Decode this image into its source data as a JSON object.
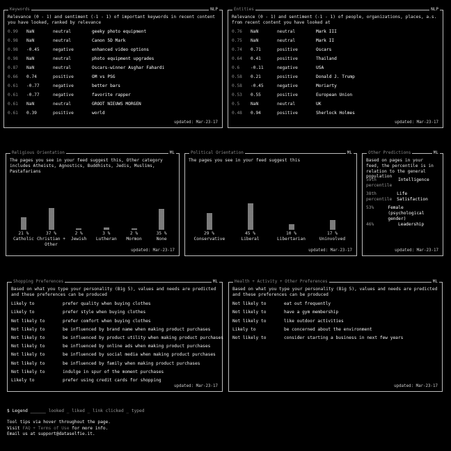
{
  "keywords": {
    "title": "Keywords",
    "tag": "NLP",
    "desc": "Relevance (0 - 1) and sentiment (-1 - 1) of important keywords in recent content you have looked, ranked by relevance",
    "rows": [
      {
        "rel": "0.99",
        "score": "NaN",
        "label": "neutral",
        "text": "geeky photo equipment"
      },
      {
        "rel": "0.98",
        "score": "NaN",
        "label": "neutral",
        "text": "Canon 5D Mark"
      },
      {
        "rel": "0.98",
        "score": "-0.45",
        "label": "negative",
        "text": "enhanced video options"
      },
      {
        "rel": "0.98",
        "score": "NaN",
        "label": "neutral",
        "text": "photo equipment upgrades"
      },
      {
        "rel": "0.87",
        "score": "NaN",
        "label": "neutral",
        "text": "Oscars-winner Asghar Fahardi"
      },
      {
        "rel": "0.66",
        "score": "0.74",
        "label": "positive",
        "text": "OM vs PSG"
      },
      {
        "rel": "0.61",
        "score": "-0.77",
        "label": "negative",
        "text": "better bars"
      },
      {
        "rel": "0.61",
        "score": "-0.77",
        "label": "negative",
        "text": "favorite rapper"
      },
      {
        "rel": "0.61",
        "score": "NaN",
        "label": "neutral",
        "text": "GROOT NIEUWS MORGEN"
      },
      {
        "rel": "0.61",
        "score": "0.39",
        "label": "positive",
        "text": "world"
      }
    ],
    "updated": "updated: Mar-23-17"
  },
  "entities": {
    "title": "Entities",
    "tag": "NLP",
    "desc": "Relevance (0 - 1) and sentiment (-1 - 1) of people, organizations, places, a.s. from recent content you have looked at",
    "rows": [
      {
        "rel": "0.76",
        "score": "NaN",
        "label": "neutral",
        "text": "Mark III"
      },
      {
        "rel": "0.75",
        "score": "NaN",
        "label": "neutral",
        "text": "Mark II"
      },
      {
        "rel": "0.74",
        "score": "0.71",
        "label": "positive",
        "text": "Oscars"
      },
      {
        "rel": "0.64",
        "score": "0.41",
        "label": "positive",
        "text": "Thailand"
      },
      {
        "rel": "0.6",
        "score": "-0.11",
        "label": "negative",
        "text": "USA"
      },
      {
        "rel": "0.58",
        "score": "0.21",
        "label": "positive",
        "text": "Donald J. Trump"
      },
      {
        "rel": "0.58",
        "score": "-0.45",
        "label": "negative",
        "text": "Moriarty"
      },
      {
        "rel": "0.53",
        "score": "0.55",
        "label": "positive",
        "text": "European Union"
      },
      {
        "rel": "0.5",
        "score": "NaN",
        "label": "neutral",
        "text": "UK"
      },
      {
        "rel": "0.48",
        "score": "0.94",
        "label": "positive",
        "text": "Sherlock Holmes"
      }
    ],
    "updated": "updated: Mar-23-17"
  },
  "religious": {
    "title": "Religious Orientation",
    "tag": "ML",
    "desc": "The pages you see in your feed suggest this, Other category includes Atheists, Agnostics, Buddhists, Jedis, Muslims, Pastafarians",
    "bars": [
      {
        "pct": "21 %",
        "label": "Catholic",
        "value": 21
      },
      {
        "pct": "37 %",
        "label": "Christian + Other",
        "value": 37
      },
      {
        "pct": "2 %",
        "label": "Jewish",
        "value": 2
      },
      {
        "pct": "3 %",
        "label": "Lutheran",
        "value": 3
      },
      {
        "pct": "2 %",
        "label": "Mormon",
        "value": 2
      },
      {
        "pct": "35 %",
        "label": "None",
        "value": 35
      }
    ],
    "updated": "updated: Mar-23-17"
  },
  "political": {
    "title": "Political Orientation",
    "tag": "ML",
    "desc": "The pages you see in your feed suggest this",
    "bars": [
      {
        "pct": "29 %",
        "label": "Conservative",
        "value": 29
      },
      {
        "pct": "45 %",
        "label": "Liberal",
        "value": 45
      },
      {
        "pct": "10 %",
        "label": "Libertarian",
        "value": 10
      },
      {
        "pct": "17 %",
        "label": "Uninvolved",
        "value": 17
      }
    ],
    "updated": "updated: Mar-23-17"
  },
  "other": {
    "title": "Other Predictions",
    "tag": "ML",
    "desc": "Based on pages in your feed, the percentile is in relation to the general population",
    "rows": [
      {
        "left": "59th percentile",
        "right": "Intelligence"
      },
      {
        "left": "38th percentile",
        "right": "Life Satisfaction"
      },
      {
        "left": "53%",
        "right": "Female (psychological gender)"
      },
      {
        "left": "46%",
        "right": "Leadership"
      }
    ],
    "updated": "updated: Mar-23-17"
  },
  "shopping": {
    "title": "Shopping Preferences",
    "tag": "ML",
    "desc": "Based on what you type your personality (Big 5), values and needs are predicted and these preferences can be produced",
    "rows": [
      {
        "left": "Likely to",
        "right": "prefer quality when buying clothes"
      },
      {
        "left": "Likely to",
        "right": "prefer style when buying clothes"
      },
      {
        "left": "Not likely to",
        "right": "prefer comfort when buying clothes"
      },
      {
        "left": "Not likely to",
        "right": "be influenced by brand name when making product purchases"
      },
      {
        "left": "Not likely to",
        "right": "be influenced by product utility when making product purchases"
      },
      {
        "left": "Not likely to",
        "right": "be influenced by online ads when making product purchases"
      },
      {
        "left": "Not likely to",
        "right": "be influenced by social media when making product purchases"
      },
      {
        "left": "Not likely to",
        "right": "be influenced by family when making product purchases"
      },
      {
        "left": "Not likely to",
        "right": "indulge in spur of the moment purchases"
      },
      {
        "left": "Likely to",
        "right": "prefer using credit cards for shopping"
      }
    ],
    "updated": "updated: Mar-23-17"
  },
  "health": {
    "title": "Health + Activity + Other Preferences",
    "tag": "ML",
    "desc": "Based on what you type your personality (Big 5), values and needs are predicted and these preferences can be produced",
    "rows": [
      {
        "left": "Not likely to",
        "right": "eat out frequently"
      },
      {
        "left": "Not likely to",
        "right": "have a gym membership"
      },
      {
        "left": "Not likely to",
        "right": "like outdoor activities"
      },
      {
        "left": "Likely to",
        "right": "be concerned about the environment"
      },
      {
        "left": "Not likely to",
        "right": "consider starting a business in next few years"
      }
    ],
    "updated": "updated: Mar-23-17"
  },
  "footer": {
    "legend_label": "$ Legend",
    "legend_blank": "______",
    "legend_items": "looked _ liked _ link clicked _ typed",
    "tooltips": "Tool tips via hover throughout the page.",
    "visit_prefix": "Visit",
    "visit_links": "FAQ + Terms of Use",
    "visit_suffix": "for more info.",
    "email": "Email us at support@dataselfie.it."
  }
}
